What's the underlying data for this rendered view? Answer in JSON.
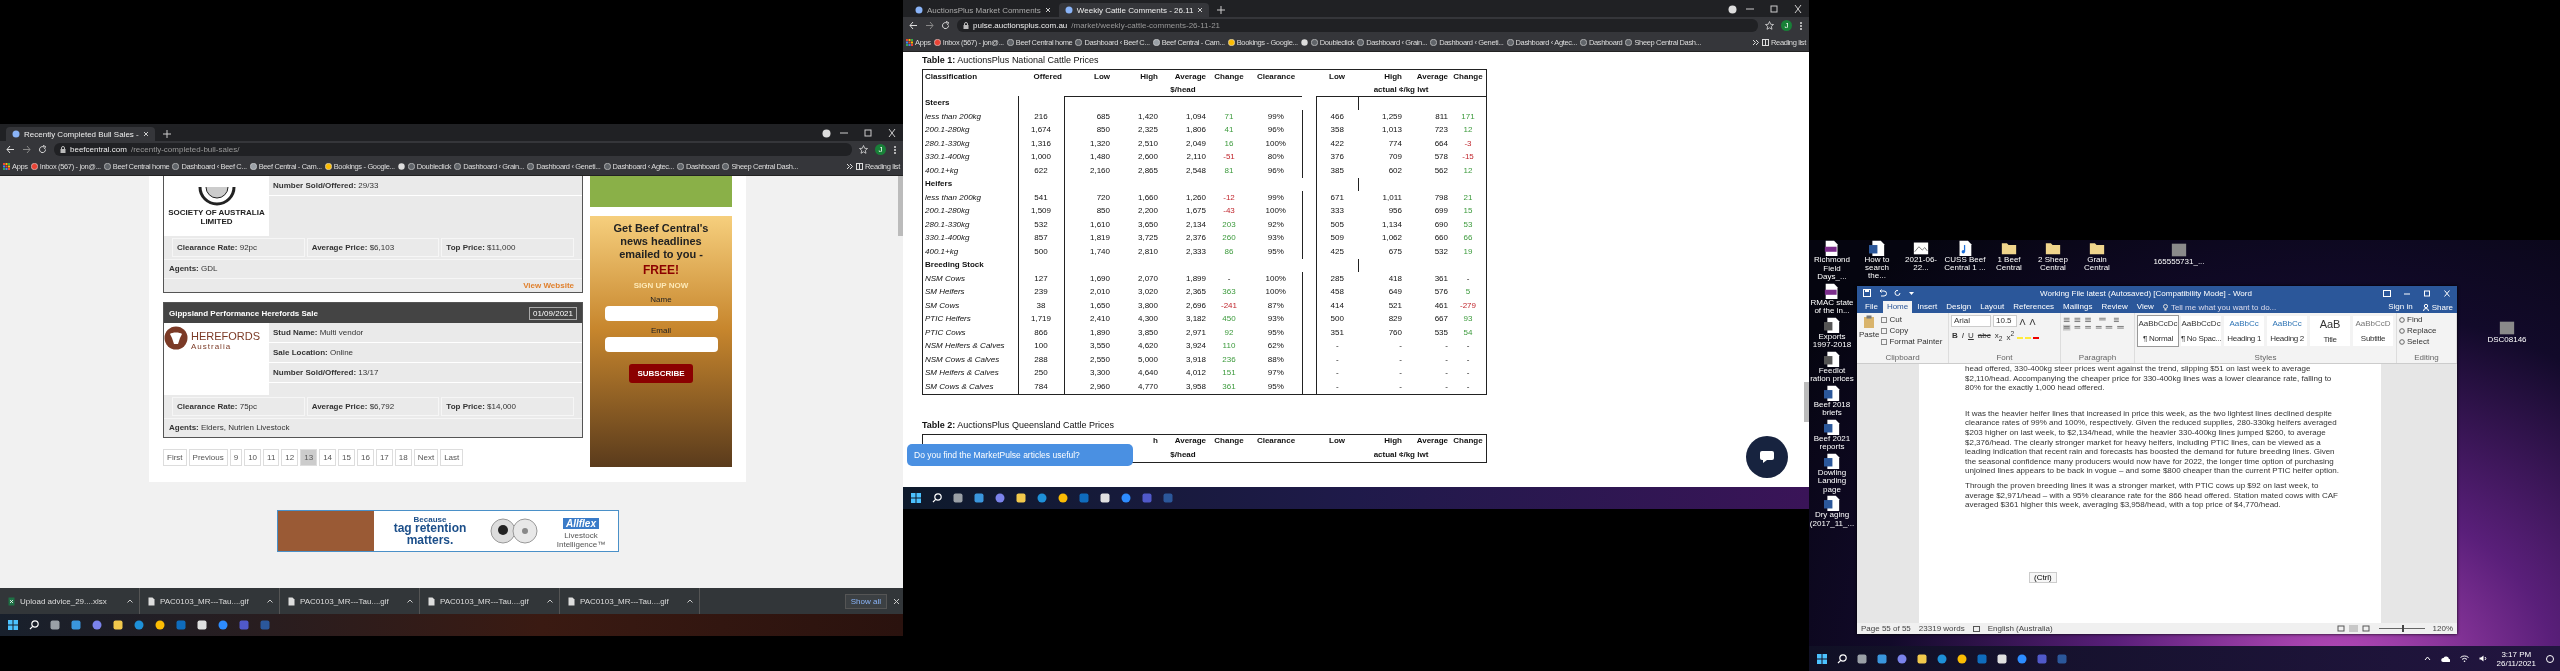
{
  "left_screen": {
    "browser": {
      "tabs": [
        {
          "title": "Recently Completed Bull Sales -",
          "selected": true
        }
      ],
      "url_host": "beefcentral.com",
      "url_path": "/recently-completed-bull-sales/",
      "profile": "J",
      "bookmarks": [
        "Apps",
        "Inbox (567) - jon@...",
        "Beef Central home",
        "Dashboard ‹ Beef C...",
        "Beef Central - Cam...",
        "Bookings - Google...",
        "Doubleclick",
        "Dashboard ‹ Grain...",
        "Dashboard ‹ Geneti...",
        "Dashboard ‹ Agtec...",
        "Dashboard",
        "Sheep Central Dash..."
      ],
      "reading_list": "Reading list"
    },
    "sales": [
      {
        "kind": "seal",
        "logo_text": "SOCIETY OF AUSTRALIA LIMITED",
        "details": [
          "**Number Sold/Offered:** 29/33"
        ],
        "stats": [
          "**Clearance Rate:** 92pc",
          "**Average Price:** $6,103",
          "**Top Price:** $11,000"
        ],
        "agents": "**Agents:** GDL",
        "link": "View Website"
      },
      {
        "kind": "herefords",
        "title": "Gippsland Performance Herefords Sale",
        "date": "01/09/2021",
        "logo_text": "HEREFORDS",
        "logo_subtext": "Australia",
        "details": [
          "**Stud Name:** Multi vendor",
          "**Sale Location:** Online",
          "**Number Sold/Offered:** 13/17"
        ],
        "stats": [
          "**Clearance Rate:** 75pc",
          "**Average Price:** $6,792",
          "**Top Price:** $14,000"
        ],
        "agents": "**Agents:** Elders, Nutrien Livestock"
      }
    ],
    "pagination": [
      {
        "label": "First",
        "selected": false
      },
      {
        "label": "Previous",
        "selected": false
      },
      {
        "label": "9",
        "selected": false
      },
      {
        "label": "10",
        "selected": false
      },
      {
        "label": "11",
        "selected": false
      },
      {
        "label": "12",
        "selected": false
      },
      {
        "label": "13",
        "selected": true
      },
      {
        "label": "14",
        "selected": false
      },
      {
        "label": "15",
        "selected": false
      },
      {
        "label": "16",
        "selected": false
      },
      {
        "label": "17",
        "selected": false
      },
      {
        "label": "18",
        "selected": false
      },
      {
        "label": "Next",
        "selected": false
      },
      {
        "label": "Last",
        "selected": false
      }
    ],
    "signup": {
      "headline": "Get Beef Central's news headlines emailed to you -",
      "offer": "FREE!",
      "call": "SIGN UP NOW",
      "fields": [
        {
          "label": "Name"
        },
        {
          "label": "Email"
        }
      ],
      "button": "SUBSCRIBE"
    },
    "banner": {
      "kicker": "Because",
      "headline_1": "tag retention",
      "headline_2": "matters.",
      "brand": "Allflex",
      "tagline": "Livestock Intelligence™"
    },
    "downloads": {
      "items": [
        {
          "name": "Upload advice_29....xlsx",
          "kind": "sheet"
        },
        {
          "name": "PAC0103_MR---Tau....gif",
          "kind": "file"
        },
        {
          "name": "PAC0103_MR---Tau....gif",
          "kind": "file"
        },
        {
          "name": "PAC0103_MR---Tau....gif",
          "kind": "file"
        },
        {
          "name": "PAC0103_MR---Tau....gif",
          "kind": "file"
        }
      ],
      "show_all": "Show all"
    }
  },
  "middle_screen": {
    "browser": {
      "tabs": [
        {
          "title": "AuctionsPlus Market Comments",
          "selected": false
        },
        {
          "title": "Weekly Cattle Comments - 26.11",
          "selected": true
        }
      ],
      "url_host": "pulse.auctionsplus.com.au",
      "url_path": "/market/weekly-cattle-comments-26-11-21",
      "profile": "J",
      "bookmarks": [
        "Apps",
        "Inbox (567) - jon@...",
        "Beef Central home",
        "Dashboard ‹ Beef C...",
        "Beef Central - Cam...",
        "Bookings - Google...",
        "Doubleclick",
        "Dashboard ‹ Grain...",
        "Dashboard ‹ Geneti...",
        "Dashboard ‹ Agtec...",
        "Dashboard",
        "Sheep Central Dash..."
      ],
      "reading_list": "Reading list"
    },
    "table_1": {
      "caption": "**Table 1:** AuctionsPlus National Cattle Prices",
      "columns": [
        "Classification",
        "Offered",
        "Low",
        "High",
        "Average",
        "Change",
        "Clearance",
        "Low",
        "High",
        "Average",
        "Change"
      ],
      "units": [
        "$/head",
        "actual ¢/kg lwt"
      ],
      "groups": [
        {
          "name": "Steers",
          "rows": [
            {
              "cells": [
                "less than 200kg",
                "216",
                "685",
                "1,420",
                "1,094",
                {
                  "text": "71",
                  "negative": false
                },
                "99%",
                "466",
                "1,259",
                "811",
                {
                  "text": "171",
                  "negative": false
                }
              ]
            },
            {
              "cells": [
                "200.1-280kg",
                "1,674",
                "850",
                "2,325",
                "1,806",
                {
                  "text": "41",
                  "negative": false
                },
                "96%",
                "358",
                "1,013",
                "723",
                {
                  "text": "12",
                  "negative": false
                }
              ]
            },
            {
              "cells": [
                "280.1-330kg",
                "1,316",
                "1,320",
                "2,510",
                "2,049",
                {
                  "text": "16",
                  "negative": false
                },
                "100%",
                "422",
                "774",
                "664",
                {
                  "text": "-3",
                  "negative": true
                }
              ]
            },
            {
              "cells": [
                "330.1-400kg",
                "1,000",
                "1,480",
                "2,600",
                "2,110",
                {
                  "text": "-51",
                  "negative": true
                },
                "80%",
                "376",
                "709",
                "578",
                {
                  "text": "-15",
                  "negative": true
                }
              ]
            },
            {
              "cells": [
                "400.1+kg",
                "622",
                "2,160",
                "2,865",
                "2,548",
                {
                  "text": "81",
                  "negative": false
                },
                "96%",
                "385",
                "602",
                "562",
                {
                  "text": "12",
                  "negative": false
                }
              ]
            }
          ]
        },
        {
          "name": "Heifers",
          "rows": [
            {
              "cells": [
                "less than 200kg",
                "541",
                "720",
                "1,660",
                "1,260",
                {
                  "text": "-12",
                  "negative": true
                },
                "99%",
                "671",
                "1,011",
                "798",
                {
                  "text": "21",
                  "negative": false
                }
              ]
            },
            {
              "cells": [
                "200.1-280kg",
                "1,509",
                "850",
                "2,200",
                "1,675",
                {
                  "text": "-43",
                  "negative": true
                },
                "100%",
                "333",
                "956",
                "699",
                {
                  "text": "15",
                  "negative": false
                }
              ]
            },
            {
              "cells": [
                "280.1-330kg",
                "532",
                "1,610",
                "3,650",
                "2,134",
                {
                  "text": "203",
                  "negative": false
                },
                "92%",
                "505",
                "1,134",
                "690",
                {
                  "text": "53",
                  "negative": false
                }
              ]
            },
            {
              "cells": [
                "330.1-400kg",
                "857",
                "1,819",
                "3,725",
                "2,376",
                {
                  "text": "260",
                  "negative": false
                },
                "93%",
                "509",
                "1,062",
                "660",
                {
                  "text": "66",
                  "negative": false
                }
              ]
            },
            {
              "cells": [
                "400.1+kg",
                "500",
                "1,740",
                "2,810",
                "2,333",
                {
                  "text": "86",
                  "negative": false
                },
                "95%",
                "425",
                "675",
                "532",
                {
                  "text": "19",
                  "negative": false
                }
              ]
            }
          ]
        },
        {
          "name": "Breeding Stock",
          "rows": [
            {
              "cells": [
                "NSM Cows",
                "127",
                "1,690",
                "2,070",
                "1,899",
                "-",
                "100%",
                "285",
                "418",
                "361",
                "-"
              ]
            },
            {
              "cells": [
                "SM Heifers",
                "239",
                "2,010",
                "3,020",
                "2,365",
                {
                  "text": "363",
                  "negative": false
                },
                "100%",
                "458",
                "649",
                "576",
                {
                  "text": "5",
                  "negative": false
                }
              ]
            },
            {
              "cells": [
                "SM Cows",
                "38",
                "1,650",
                "3,800",
                "2,696",
                {
                  "text": "-241",
                  "negative": true
                },
                "87%",
                "414",
                "521",
                "461",
                {
                  "text": "-279",
                  "negative": true
                }
              ]
            },
            {
              "cells": [
                "PTIC Heifers",
                "1,719",
                "2,410",
                "4,300",
                "3,182",
                {
                  "text": "450",
                  "negative": false
                },
                "93%",
                "500",
                "829",
                "667",
                {
                  "text": "93",
                  "negative": false
                }
              ]
            },
            {
              "cells": [
                "PTIC Cows",
                "866",
                "1,890",
                "3,850",
                "2,971",
                {
                  "text": "92",
                  "negative": false
                },
                "95%",
                "351",
                "760",
                "535",
                {
                  "text": "54",
                  "negative": false
                }
              ]
            },
            {
              "cells": [
                "NSM Heifers & Calves",
                "100",
                "3,550",
                "4,620",
                "3,924",
                {
                  "text": "110",
                  "negative": false
                },
                "62%",
                "-",
                "-",
                "-",
                "-"
              ]
            },
            {
              "cells": [
                "NSM Cows & Calves",
                "288",
                "2,550",
                "5,000",
                "3,918",
                {
                  "text": "236",
                  "negative": false
                },
                "88%",
                "-",
                "-",
                "-",
                "-"
              ]
            },
            {
              "cells": [
                "SM Heifers & Calves",
                "250",
                "3,300",
                "4,640",
                "4,012",
                {
                  "text": "151",
                  "negative": false
                },
                "97%",
                "-",
                "-",
                "-",
                "-"
              ]
            },
            {
              "cells": [
                "SM Cows & Calves",
                "784",
                "2,960",
                "4,770",
                "3,958",
                {
                  "text": "361",
                  "negative": false
                },
                "95%",
                "-",
                "-",
                "-",
                "-"
              ]
            }
          ]
        }
      ]
    },
    "table_2": {
      "caption": "**Table 2:** AuctionsPlus Queensland Cattle Prices",
      "columns": [
        "h",
        "Average",
        "Change",
        "Clearance",
        "Low",
        "High",
        "Average",
        "Change"
      ],
      "units": [
        "$/head",
        "actual ¢/kg lwt"
      ]
    },
    "feedback_popup": "Do you find the MarketPulse articles useful?"
  },
  "right_screen": {
    "desktop_column": [
      {
        "label": "Richmond Field Days_...",
        "kind": "pdf"
      },
      {
        "label": "RMAC state of the in...",
        "kind": "pdf"
      },
      {
        "label": "Exports 1997-2018",
        "kind": "excel"
      },
      {
        "label": "Feedlot ration prices",
        "kind": "excel"
      },
      {
        "label": "Beef 2018 briefs",
        "kind": "word"
      },
      {
        "label": "Beef 2021 reports",
        "kind": "word"
      },
      {
        "label": "Dowling Landing page",
        "kind": "word"
      },
      {
        "label": "Dry aging (2017_11_...",
        "kind": "word"
      }
    ],
    "desktop_row": [
      {
        "label": "How to search the...",
        "kind": "word"
      },
      {
        "label": "2021-06-22...",
        "kind": "image"
      },
      {
        "label": "CUSS Beef Central 1 ...",
        "kind": "audio"
      },
      {
        "label": "1 Beef Central",
        "kind": "folder"
      },
      {
        "label": "2 Sheep Central",
        "kind": "folder"
      },
      {
        "label": "Grain Central",
        "kind": "folder"
      }
    ],
    "desktop_loose": [
      {
        "label": "165555731_...",
        "kind": "photo"
      },
      {
        "label": "DSC08146",
        "kind": "photo"
      }
    ],
    "word": {
      "title": "Working File latest (Autosaved) [Compatibility Mode] - Word",
      "tabs": [
        {
          "label": "File",
          "selected": false
        },
        {
          "label": "Home",
          "selected": true
        },
        {
          "label": "Insert",
          "selected": false
        },
        {
          "label": "Design",
          "selected": false
        },
        {
          "label": "Layout",
          "selected": false
        },
        {
          "label": "References",
          "selected": false
        },
        {
          "label": "Mailings",
          "selected": false
        },
        {
          "label": "Review",
          "selected": false
        },
        {
          "label": "View",
          "selected": false
        }
      ],
      "tell_me": "Tell me what you want to do...",
      "sign_in": "Sign in",
      "share": "Share",
      "clipboard": {
        "paste": "Paste",
        "cut": "Cut",
        "copy": "Copy",
        "format_painter": "Format Painter",
        "group": "Clipboard"
      },
      "font": {
        "name": "Arial",
        "size": "10.5",
        "buttons": [
          "B",
          "I",
          "U",
          "abc",
          "x$_{2}$",
          "x$^{2}$"
        ],
        "group": "Font"
      },
      "paragraph_group": "Paragraph",
      "styles": [
        {
          "sample": "AaBbCcDc",
          "name": "¶ Normal",
          "selected": true
        },
        {
          "sample": "AaBbCcDc",
          "name": "¶ No Spac...",
          "selected": false
        },
        {
          "sample": "AaBbCc",
          "name": "Heading 1",
          "selected": false
        },
        {
          "sample": "AaBbCc",
          "name": "Heading 2",
          "selected": false
        },
        {
          "sample": "AaB",
          "name": "Title",
          "selected": false
        },
        {
          "sample": "AaBbCcD",
          "name": "Subtitle",
          "selected": false
        }
      ],
      "styles_group": "Styles",
      "editing": [
        "Find",
        "Replace",
        "Select"
      ],
      "editing_group": "Editing",
      "paragraphs": [
        "head offered, 330-400kg steer prices went against the trend, slipping $51 on last week to average $2,110/head. Accompanying the cheaper price for 330-400kg lines was a lower clearance rate, falling to 80% for the exactly 1,000 head offered.",
        "It was the heavier heifer lines that increased in price this week, as the two lightest lines declined despite clearance rates of 99% and 100%, respectively. Given the reduced supplies, 280-330kg heifers averaged $203 higher on last week, to $2,134/head, while the heavier 330-400kg lines jumped $260, to average $2,376/head. The clearly stronger market for heavy heifers, including PTIC lines, can be viewed as a leading indication that recent rain and forecasts has boosted the demand for future breeding lines. Given the seasonal confidence many producers would now have for 2022, the longer time option of purchasing unjoined lines appears to be back in vogue – and some $800 cheaper than the current PTIC heifer option.",
        "Through the proven breeding lines it was a stronger market, with PTIC cows up $92 on last week, to average $2,971/head – with a 95% clearance rate for the 866 head offered. Station mated cows with CAF averaged $361 higher this week, averaging $3,958/head, with a top price of $4,770/head."
      ],
      "paste_options": "(Ctrl)",
      "status": {
        "page": "Page 55 of 55",
        "words": "23319 words",
        "language": "English (Australia)",
        "zoom": "120%",
        "level": 0.5
      }
    },
    "clock": {
      "time": "3:17 PM",
      "date": "26/11/2021"
    }
  }
}
